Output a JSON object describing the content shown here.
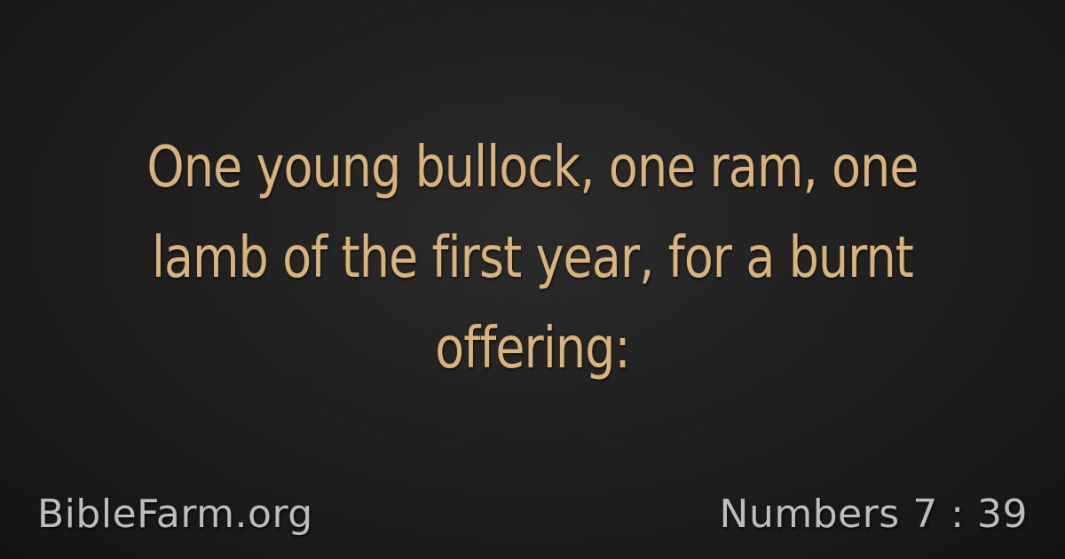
{
  "verse": {
    "text": "One young bullock, one ram, one lamb of the first year, for a burnt offering:"
  },
  "footer": {
    "site": "BibleFarm.org",
    "reference": "Numbers 7 : 39"
  },
  "colors": {
    "background": "#1e1e1e",
    "verse_text": "#d8b37c",
    "footer_text": "#bdbdbd"
  }
}
